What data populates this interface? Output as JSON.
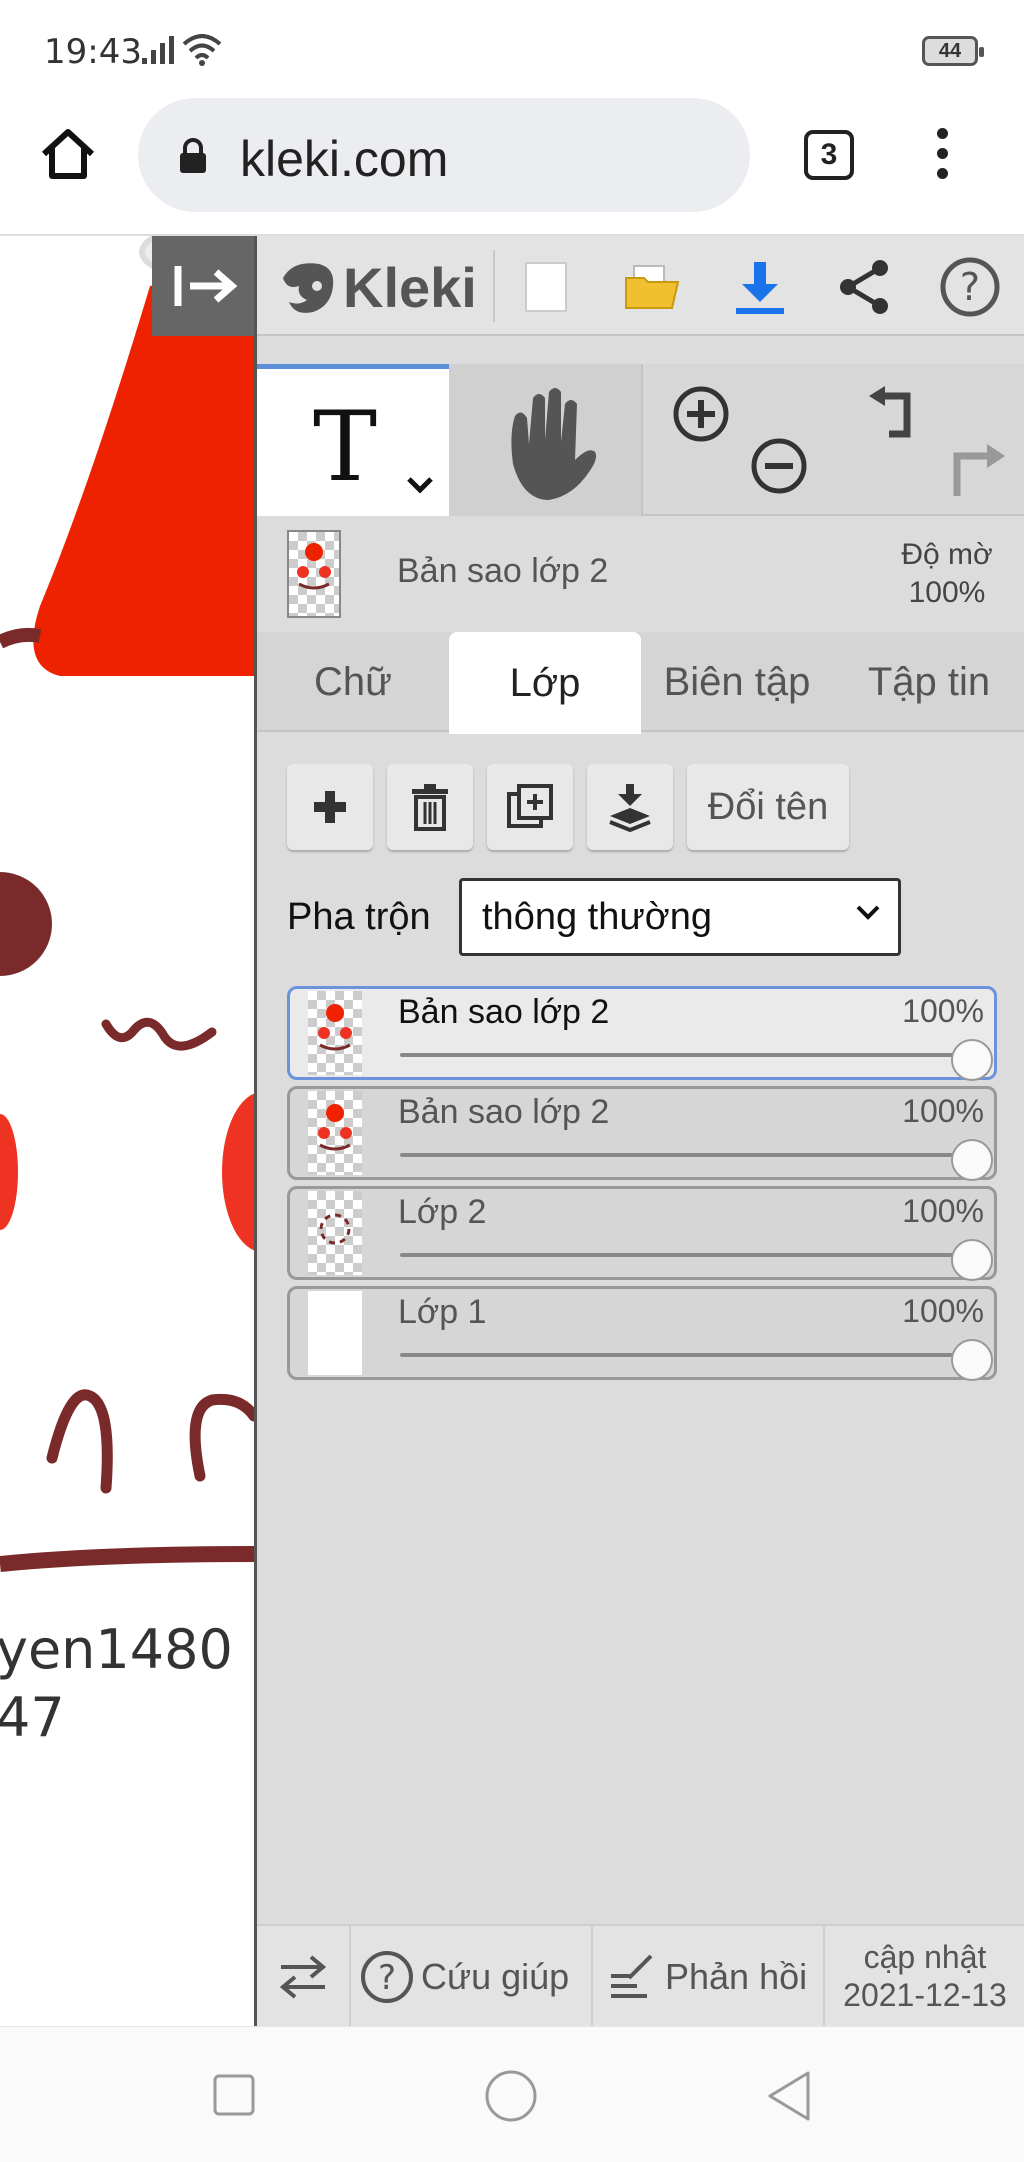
{
  "status_bar": {
    "time": "19:43",
    "battery": "44"
  },
  "browser": {
    "url": "kleki.com",
    "tab_count": "3"
  },
  "canvas": {
    "visible_text": [
      "yen1480",
      "47"
    ]
  },
  "app": {
    "logo": "Kleki",
    "active_layer": {
      "name": "Bản sao lớp 2",
      "opacity_label": "Độ mờ",
      "opacity_value": "100%"
    },
    "tabs": [
      {
        "label": "Chữ",
        "active": false
      },
      {
        "label": "Lớp",
        "active": true
      },
      {
        "label": "Biên tập",
        "active": false
      },
      {
        "label": "Tập tin",
        "active": false
      }
    ],
    "rename_label": "Đổi tên",
    "blend": {
      "label": "Pha trộn",
      "value": "thông thường"
    },
    "layers": [
      {
        "name": "Bản sao lớp 2",
        "opacity": "100%",
        "opacity_fraction": 1.0,
        "selected": true
      },
      {
        "name": "Bản sao lớp 2",
        "opacity": "100%",
        "opacity_fraction": 1.0,
        "selected": false
      },
      {
        "name": "Lớp 2",
        "opacity": "100%",
        "opacity_fraction": 1.0,
        "selected": false
      },
      {
        "name": "Lớp 1",
        "opacity": "100%",
        "opacity_fraction": 1.0,
        "selected": false
      }
    ],
    "footer": {
      "help": "Cứu giúp",
      "feedback": "Phản hồi",
      "update_label": "cập nhật",
      "update_date": "2021-12-13"
    }
  },
  "colors": {
    "accent_blue": "#5b8fd9",
    "download_blue": "#1a73e8",
    "folder_yellow": "#f0c030",
    "santa_red": "#ee2200",
    "outline_brown": "#7a2a2a"
  }
}
